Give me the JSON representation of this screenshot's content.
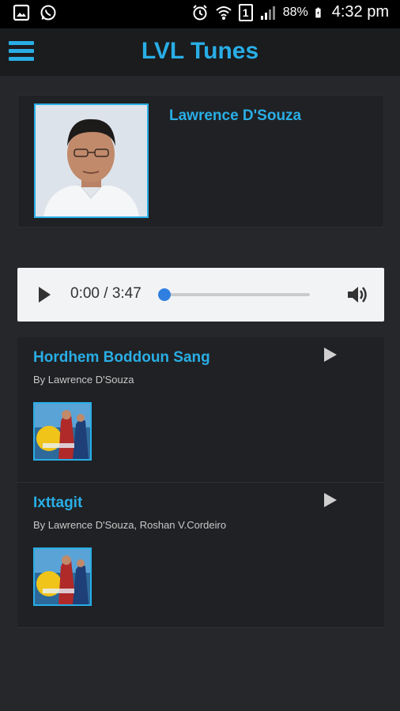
{
  "status_bar": {
    "battery": "88%",
    "time": "4:32 pm",
    "sim_label": "1",
    "icons": [
      "image-icon",
      "whatsapp-icon",
      "alarm-icon",
      "wifi-icon",
      "sim-icon",
      "signal-icon",
      "battery-icon"
    ]
  },
  "app_bar": {
    "title": "LVL Tunes",
    "accent_color": "#29aee6"
  },
  "artist": {
    "name": "Lawrence D'Souza"
  },
  "player": {
    "time": "0:00 / 3:47",
    "progress": 0
  },
  "tracks": [
    {
      "title": "Hordhem Boddoun Sang",
      "artists": "By Lawrence D'Souza"
    },
    {
      "title": "Ixttagit",
      "artists": "By Lawrence D'Souza, Roshan V.Cordeiro"
    }
  ]
}
